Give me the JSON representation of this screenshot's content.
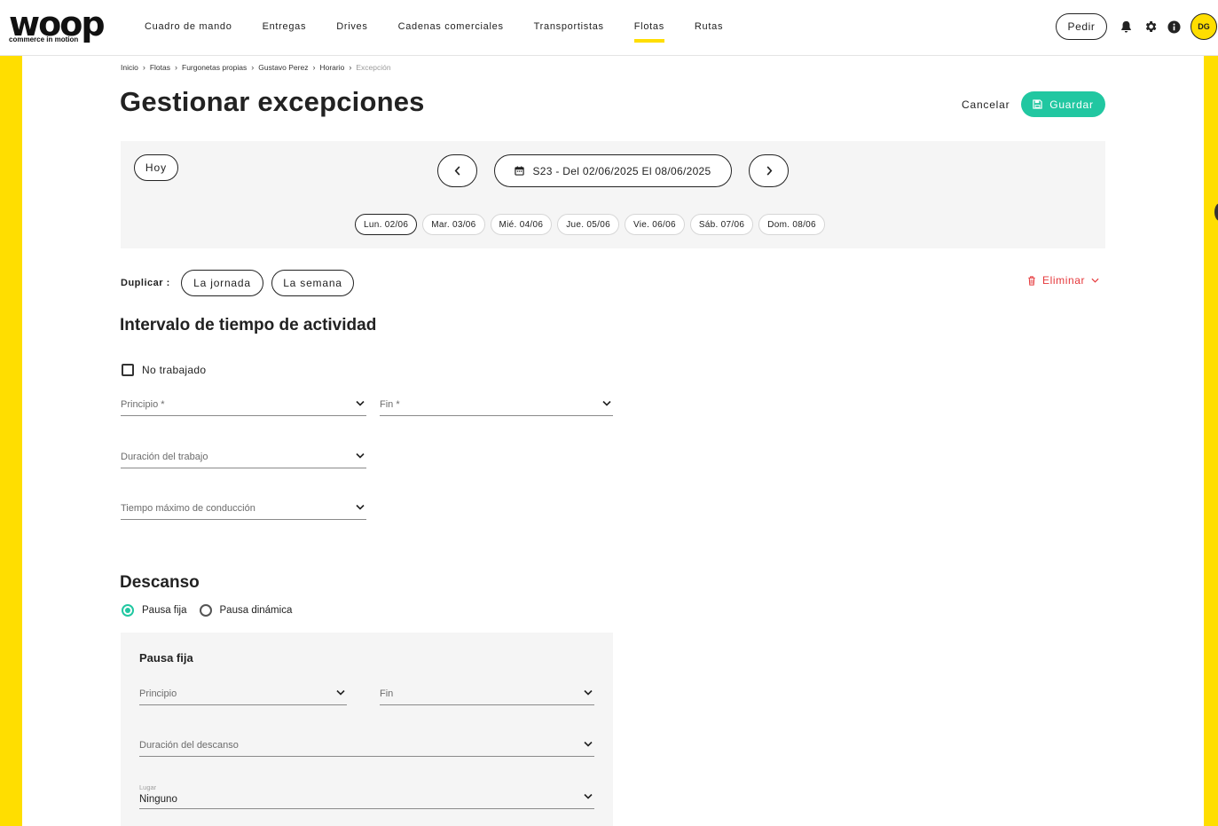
{
  "brand": {
    "logo_word": "woop",
    "logo_tagline": "commerce in motion",
    "accent": "#ffde00",
    "primary": "#21c7a1",
    "danger": "#e5383b"
  },
  "nav": {
    "items": [
      {
        "label": "Cuadro de mando"
      },
      {
        "label": "Entregas"
      },
      {
        "label": "Drives"
      },
      {
        "label": "Cadenas comerciales"
      },
      {
        "label": "Transportistas"
      },
      {
        "label": "Flotas",
        "active": true
      },
      {
        "label": "Rutas"
      }
    ],
    "order_button": "Pedir",
    "icons": [
      "bell-icon",
      "gear-icon",
      "info-icon"
    ],
    "avatar_initials": "DG"
  },
  "breadcrumb": [
    "Inicio",
    "Flotas",
    "Furgonetas propias",
    "Gustavo Perez",
    "Horario",
    "Excepción"
  ],
  "page": {
    "title": "Gestionar excepciones",
    "cancel_label": "Cancelar",
    "save_label": "Guardar"
  },
  "week": {
    "today_label": "Hoy",
    "range_label": "S23 - Del 02/06/2025 El 08/06/2025",
    "days": [
      {
        "label": "Lun. 02/06",
        "active": true
      },
      {
        "label": "Mar. 03/06"
      },
      {
        "label": "Mié. 04/06"
      },
      {
        "label": "Jue. 05/06"
      },
      {
        "label": "Vie. 06/06"
      },
      {
        "label": "Sáb. 07/06"
      },
      {
        "label": "Dom. 08/06"
      }
    ]
  },
  "duplicate": {
    "label": "Duplicar :",
    "day_button": "La jornada",
    "week_button": "La semana",
    "delete_label": "Eliminar"
  },
  "activity": {
    "title": "Intervalo de tiempo de actividad",
    "not_worked_label": "No trabajado",
    "start_label": "Principio *",
    "end_label": "Fin *",
    "work_duration_label": "Duración del trabajo",
    "max_driving_label": "Tiempo máximo de conducción"
  },
  "rest": {
    "title": "Descanso",
    "fixed_option": "Pausa fija",
    "dynamic_option": "Pausa dinámica",
    "selected": "Pausa fija",
    "card": {
      "title": "Pausa fija",
      "start_label": "Principio",
      "end_label": "Fin",
      "duration_label": "Duración del descanso",
      "place_label": "Lugar",
      "place_value": "Ninguno"
    }
  }
}
